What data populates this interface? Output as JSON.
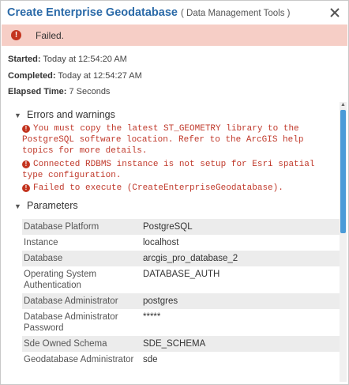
{
  "window": {
    "title": "Create Enterprise Geodatabase",
    "subtitle": "( Data Management Tools )",
    "close_icon": "close-icon"
  },
  "status": {
    "text": "Failed.",
    "color": "#f6cec6",
    "icon": "error-icon"
  },
  "info": {
    "started_label": "Started:",
    "started_value": "Today at 12:54:20 AM",
    "completed_label": "Completed:",
    "completed_value": "Today at 12:54:27 AM",
    "elapsed_label": "Elapsed Time:",
    "elapsed_value": "7 Seconds"
  },
  "errors": {
    "header": "Errors and warnings",
    "messages": [
      "You must copy the latest ST_GEOMETRY library to the PostgreSQL software location. Refer to the ArcGIS help topics for more details.",
      "Connected RDBMS instance is not setup for Esri spatial type configuration.",
      "Failed to execute (CreateEnterpriseGeodatabase)."
    ]
  },
  "parameters": {
    "header": "Parameters",
    "rows": [
      {
        "name": "Database Platform",
        "value": "PostgreSQL"
      },
      {
        "name": "Instance",
        "value": "localhost"
      },
      {
        "name": "Database",
        "value": "arcgis_pro_database_2"
      },
      {
        "name": "Operating System Authentication",
        "value": "DATABASE_AUTH"
      },
      {
        "name": "Database Administrator",
        "value": "postgres"
      },
      {
        "name": "Database Administrator Password",
        "value": "*****"
      },
      {
        "name": "Sde Owned Schema",
        "value": "SDE_SCHEMA"
      },
      {
        "name": "Geodatabase Administrator",
        "value": "sde"
      }
    ]
  },
  "colors": {
    "accent": "#2b6aa8",
    "error": "#c0392b",
    "scroll_thumb": "#4a9bd8"
  }
}
